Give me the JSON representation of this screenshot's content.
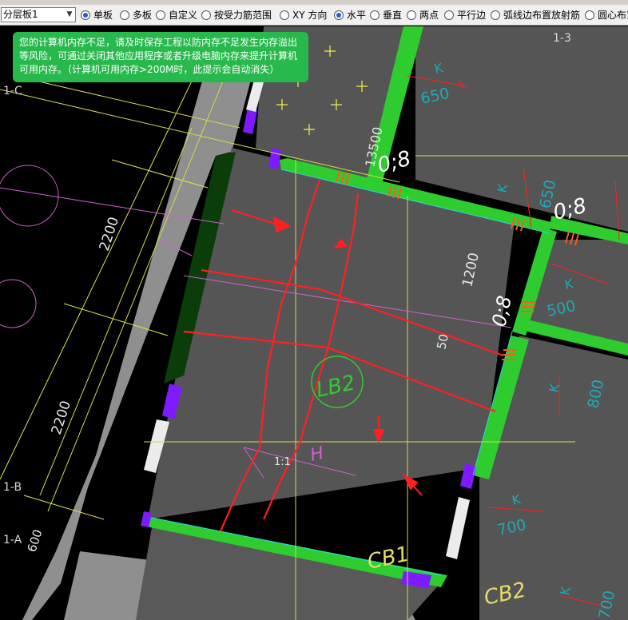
{
  "toolbar": {
    "layer_select": {
      "value": "分层板1"
    },
    "options": [
      {
        "label": "单板",
        "selected": true
      },
      {
        "label": "多板",
        "selected": false
      },
      {
        "label": "自定义",
        "selected": false
      },
      {
        "label": "按受力筋范围",
        "selected": false
      },
      {
        "label": "XY 方向",
        "selected": false
      },
      {
        "label": "水平",
        "selected": true
      },
      {
        "label": "垂直",
        "selected": false
      },
      {
        "label": "两点",
        "selected": false
      },
      {
        "label": "平行边",
        "selected": false
      },
      {
        "label": "弧线边布置放射筋",
        "selected": false
      },
      {
        "label": "圆心布置",
        "selected": false
      }
    ]
  },
  "notice": {
    "text": "您的计算机内存不足，请及时保存工程以防内存不足发生内存溢出等风险，可通过关闭其他应用程序或者升级电脑内存来提升计算机可用内存。（计算机可用内存>200M时，此提示会自动消失）"
  },
  "drawing": {
    "axis_labels": {
      "c": "1-C",
      "b": "1-B",
      "a": "1-A",
      "top": "1-3"
    },
    "dimensions": {
      "span_top": "13500",
      "upper_left": "2200",
      "lower_left": "2200",
      "mid": "1200",
      "bottom_left": "600",
      "partial": "50"
    },
    "slab_values": [
      "0;8",
      "0;8",
      "0;8"
    ],
    "rebar_k": [
      "K",
      "650",
      "K",
      "650",
      "K",
      "500",
      "K",
      "800",
      "K",
      "700",
      "K",
      "700"
    ],
    "slab_names": {
      "main": "LB2",
      "cb1": "CB1",
      "cb2": "CB2"
    },
    "misc": {
      "h": "H",
      "ratio": "1:1"
    }
  },
  "colors": {
    "background": "#000000",
    "slab": "#555555",
    "wall": "#2ecc2e",
    "column": "#7e1aff",
    "beam_gray": "#8f8f8f",
    "annotation": "#ff2a2a",
    "dim_yellow": "#f2f24a",
    "cyan_text": "#1fa8b8",
    "notice_bg": "#28b94d"
  }
}
